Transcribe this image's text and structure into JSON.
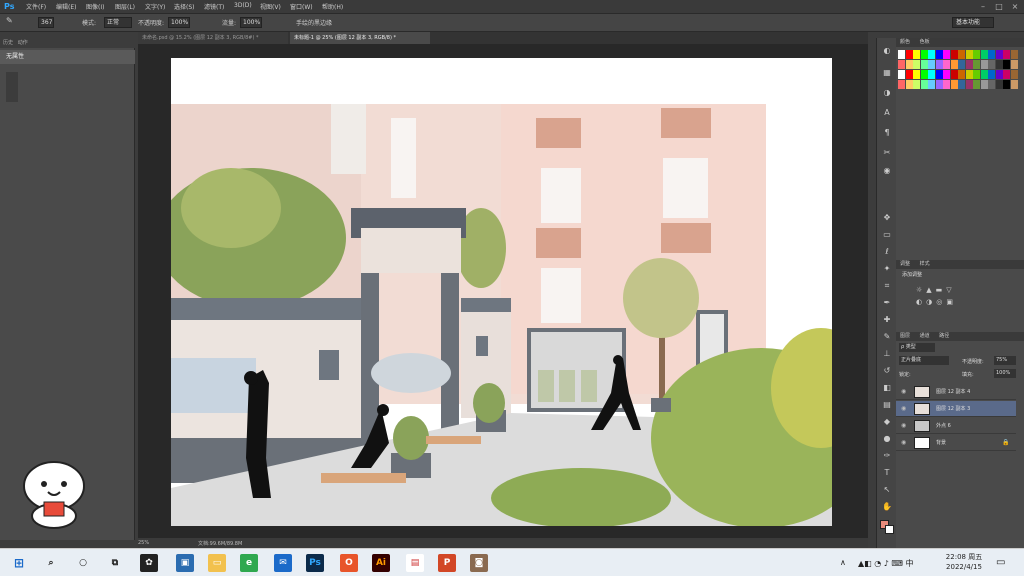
{
  "app": {
    "logo": "Ps"
  },
  "menu": [
    "文件(F)",
    "编辑(E)",
    "图像(I)",
    "图层(L)",
    "文字(Y)",
    "选择(S)",
    "滤镜(T)",
    "3D(D)",
    "视图(V)",
    "窗口(W)",
    "帮助(H)"
  ],
  "options": {
    "size": "367",
    "mode_label": "模式:",
    "mode_value": "正常",
    "opacity_label": "不透明度:",
    "opacity_value": "100%",
    "flow_label": "流量:",
    "flow_value": "100%",
    "airbrush_label": "手绘的黑边缘",
    "workspace": "基本功能"
  },
  "left_panel": {
    "tabs": [
      "历史",
      "动作"
    ],
    "snapshot": "无属性"
  },
  "doc_tabs": [
    {
      "label": "未命名.psd @ 15.2% (图层 12 副本 3, RGB/8#) *",
      "active": false
    },
    {
      "label": "未标题-1 @ 25% (图层 12 副本 3, RGB/8) *",
      "active": true
    }
  ],
  "status": {
    "zoom": "25%",
    "doc": "文档:99.6M/89.8M"
  },
  "right_panel": {
    "color_tabs": [
      "颜色",
      "色板"
    ],
    "adjust_tabs": [
      "调整",
      "样式"
    ],
    "adjust_title": "添加调整",
    "layers_tabs": [
      "图层",
      "通道",
      "路径"
    ],
    "kind": "ρ 类型",
    "blend": "正片叠底",
    "opacity_label": "不透明度:",
    "opacity": "75%",
    "lock_label": "锁定:",
    "fill_label": "填充:",
    "fill": "100%",
    "layers": [
      {
        "name": "图层 12 副本 4",
        "selected": false
      },
      {
        "name": "图层 12 副本 3",
        "selected": true
      },
      {
        "name": "外点 6",
        "selected": false
      },
      {
        "name": "背景",
        "selected": false
      }
    ]
  },
  "taskbar": {
    "time": "22:08 周五",
    "date": "2022/4/15"
  },
  "swatch_colors": [
    "#ffffff",
    "#ff0000",
    "#ffff00",
    "#00ff00",
    "#00ffff",
    "#0000ff",
    "#ff00ff",
    "#cc0000",
    "#cc6600",
    "#cccc00",
    "#66cc00",
    "#00cc66",
    "#0066cc",
    "#6600cc",
    "#cc0066",
    "#996633",
    "#ff6666",
    "#ffcc66",
    "#ccff66",
    "#66ff99",
    "#66ccff",
    "#9966ff",
    "#ff66cc",
    "#ff9933",
    "#336699",
    "#993366",
    "#669933",
    "#999999",
    "#666666",
    "#333333",
    "#000000",
    "#cc9966"
  ]
}
